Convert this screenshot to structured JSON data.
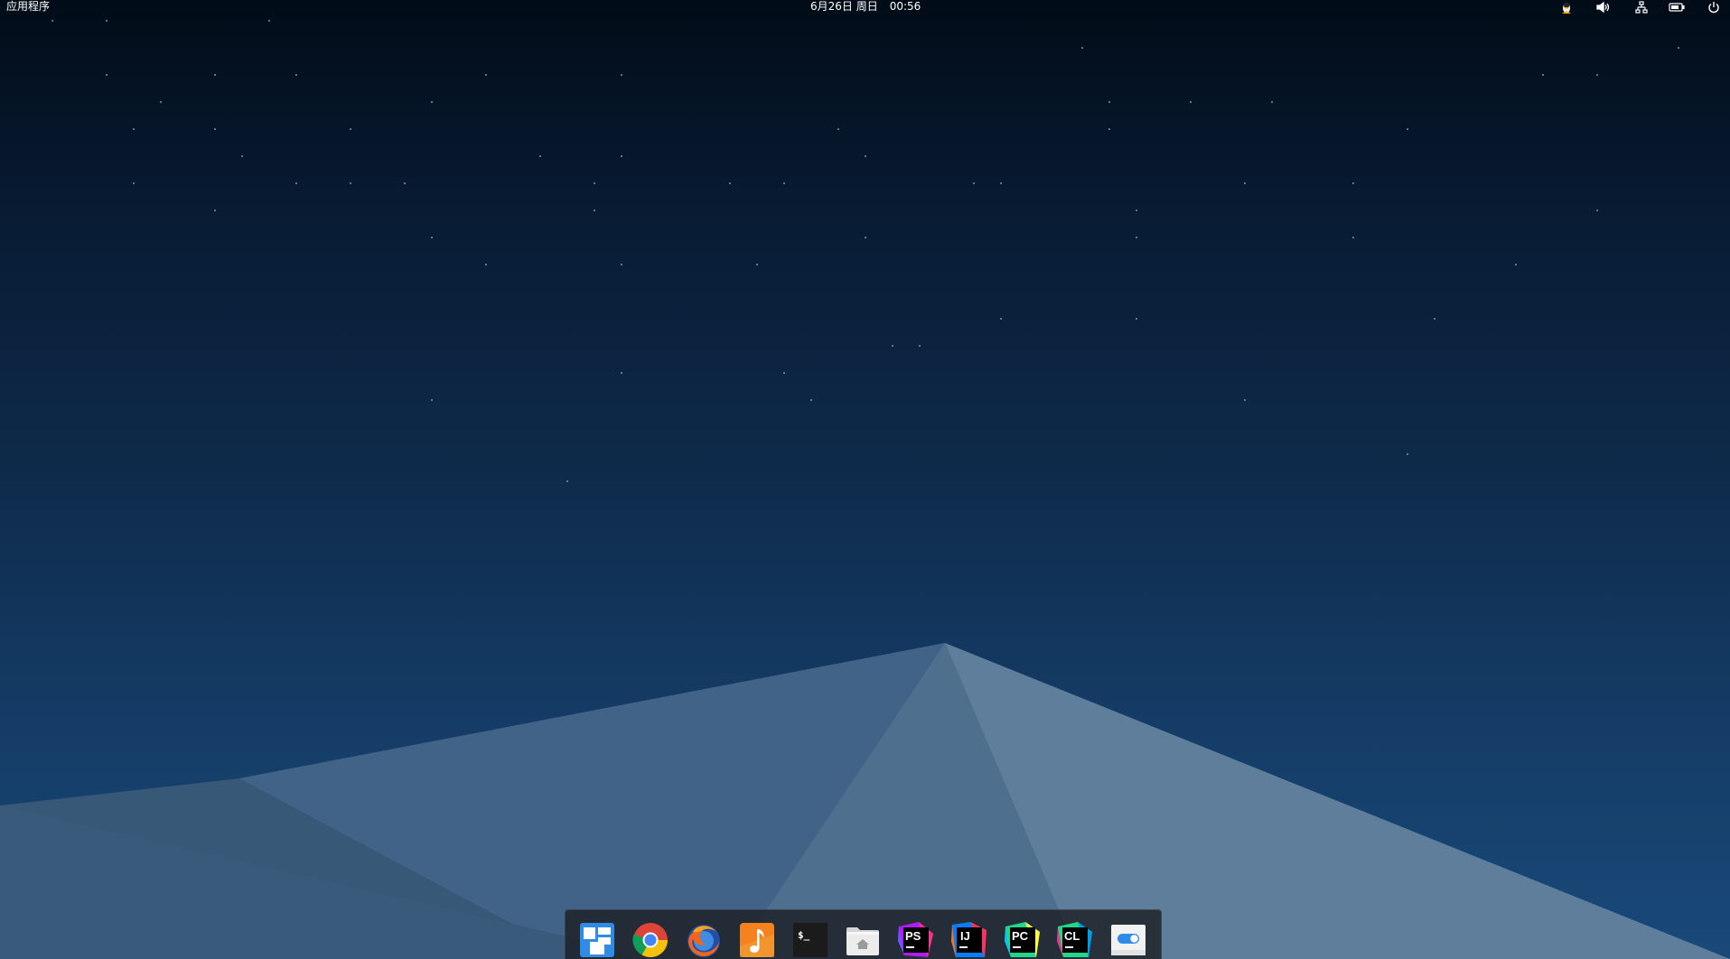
{
  "top_panel": {
    "applications_label": "应用程序",
    "date": "6月26日 周日",
    "time": "00:56",
    "tray": [
      {
        "name": "qq-penguin-icon"
      },
      {
        "name": "volume-icon"
      },
      {
        "name": "network-icon"
      },
      {
        "name": "battery-icon"
      },
      {
        "name": "power-icon"
      }
    ]
  },
  "dock": {
    "items": [
      {
        "name": "multitasking-view",
        "icon": "multitasking-view-icon"
      },
      {
        "name": "google-chrome",
        "icon": "chrome-icon"
      },
      {
        "name": "firefox",
        "icon": "firefox-icon"
      },
      {
        "name": "music",
        "icon": "music-icon"
      },
      {
        "name": "terminal",
        "icon": "terminal-icon",
        "glyph": "$_"
      },
      {
        "name": "files",
        "icon": "files-icon"
      },
      {
        "name": "phpstorm",
        "icon": "phpstorm-icon",
        "glyph": "PS"
      },
      {
        "name": "intellij-idea",
        "icon": "intellij-idea-icon",
        "glyph": "IJ"
      },
      {
        "name": "pycharm",
        "icon": "pycharm-icon",
        "glyph": "PC"
      },
      {
        "name": "clion",
        "icon": "clion-icon",
        "glyph": "CL"
      },
      {
        "name": "system-settings",
        "icon": "settings-toggle-icon"
      }
    ]
  },
  "colors": {
    "sky_top": "#020c18",
    "sky_bottom": "#19497a",
    "mountain_left": "#3f5f7f",
    "mountain_mid": "#4a6b8b",
    "mountain_right": "#5e7f9e",
    "dock_background": "#1c1f24"
  }
}
